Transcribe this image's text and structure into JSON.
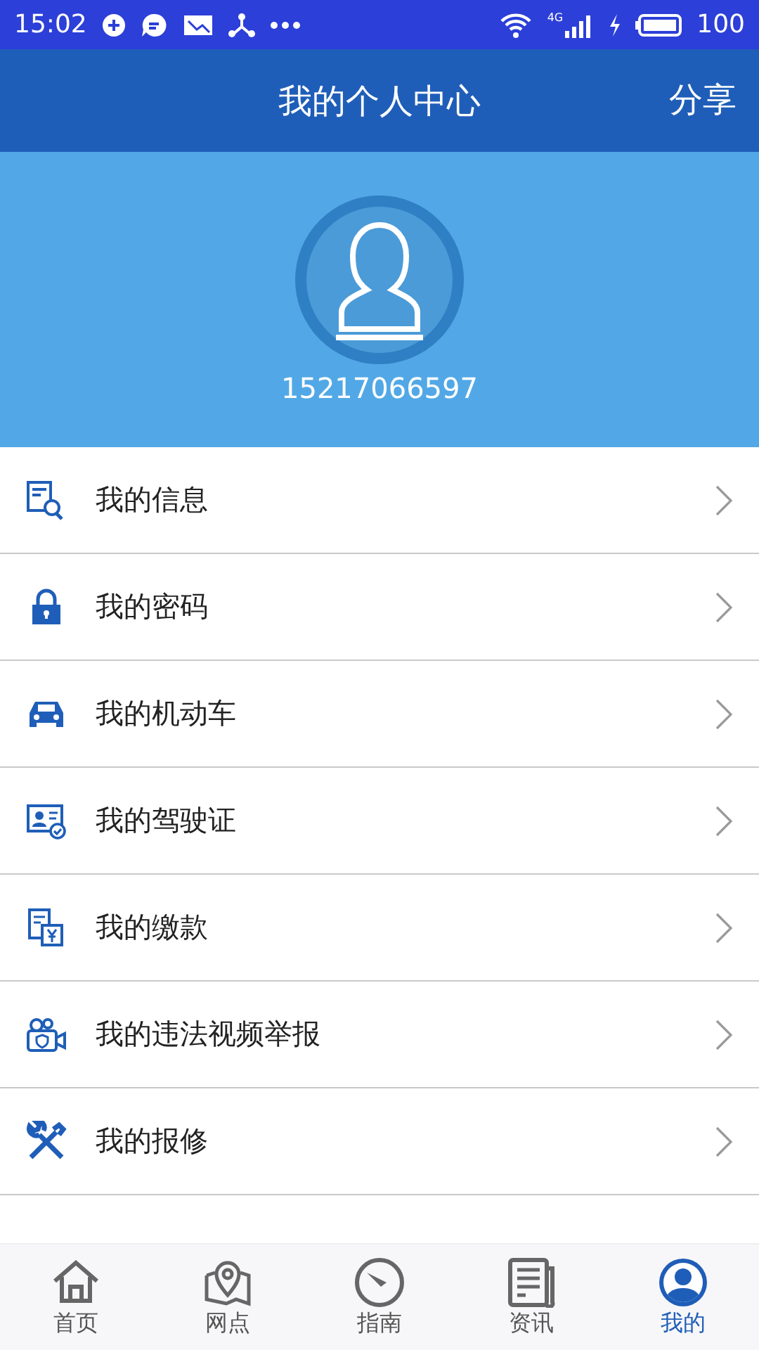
{
  "status_bar": {
    "time": "15:02",
    "network": "4G",
    "battery": "100"
  },
  "header": {
    "title": "我的个人中心",
    "action": "分享"
  },
  "profile": {
    "phone": "15217066597"
  },
  "menu": [
    {
      "label": "我的信息"
    },
    {
      "label": "我的密码"
    },
    {
      "label": "我的机动车"
    },
    {
      "label": "我的驾驶证"
    },
    {
      "label": "我的缴款"
    },
    {
      "label": "我的违法视频举报"
    },
    {
      "label": "我的报修"
    }
  ],
  "tabs": [
    {
      "label": "首页",
      "selected": false
    },
    {
      "label": "网点",
      "selected": false
    },
    {
      "label": "指南",
      "selected": false
    },
    {
      "label": "资讯",
      "selected": false
    },
    {
      "label": "我的",
      "selected": true
    }
  ]
}
